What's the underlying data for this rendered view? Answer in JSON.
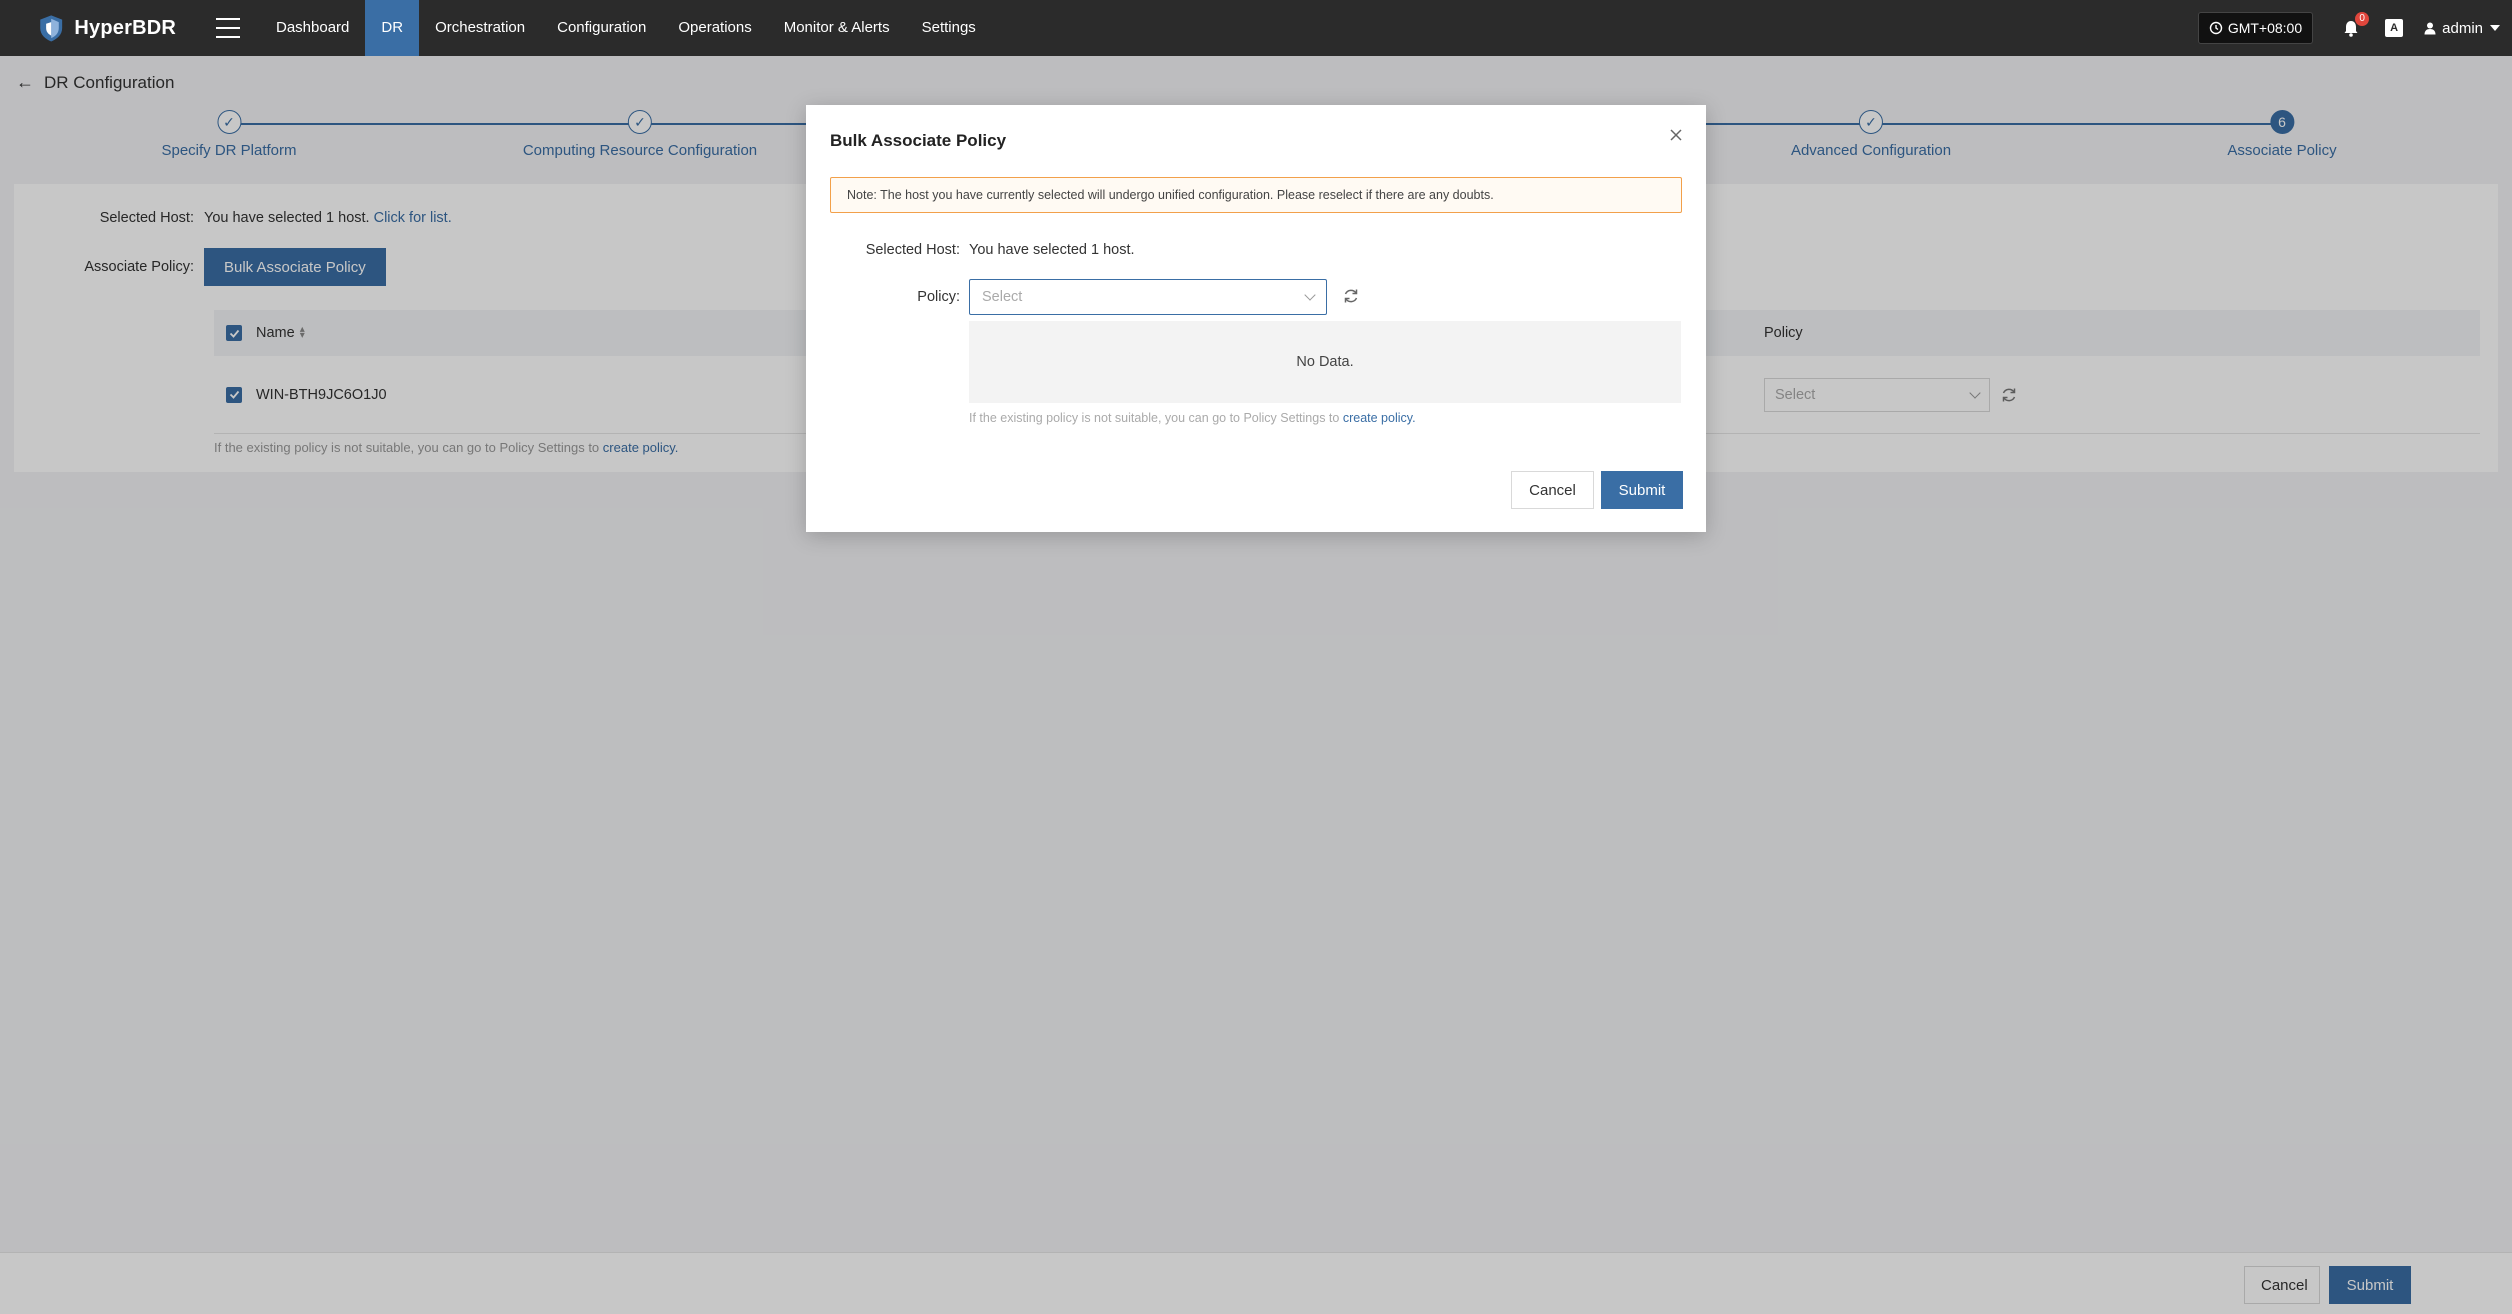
{
  "app": {
    "name": "HyperBDR"
  },
  "nav": {
    "items": [
      "Dashboard",
      "DR",
      "Orchestration",
      "Configuration",
      "Operations",
      "Monitor & Alerts",
      "Settings"
    ],
    "active": "DR"
  },
  "header_right": {
    "timezone": "GMT+08:00",
    "notification_count": "0",
    "lang_icon": "A",
    "user": "admin"
  },
  "page": {
    "title": "DR Configuration"
  },
  "steps": [
    {
      "label": "Specify DR Platform",
      "state": "done"
    },
    {
      "label": "Computing Resource Configuration",
      "state": "done"
    },
    {
      "label": "Advanced Configuration",
      "state": "done"
    },
    {
      "label": "Associate Policy",
      "state": "current",
      "number": "6"
    }
  ],
  "content": {
    "selected_host_label": "Selected Host:",
    "selected_prefix": "You have selected",
    "selected_count": "1",
    "selected_suffix": "host.",
    "click_for_list": "Click for list.",
    "associate_policy_label": "Associate Policy:",
    "bulk_button": "Bulk Associate Policy",
    "table": {
      "headers": {
        "name": "Name",
        "policy": "Policy"
      },
      "rows": [
        {
          "name": "WIN-BTH9JC6O1J0",
          "policy_placeholder": "Select"
        }
      ]
    },
    "hint_prefix": "If the existing policy is not suitable, you can go to Policy Settings to",
    "hint_link": "create policy."
  },
  "footer": {
    "cancel": "Cancel",
    "submit": "Submit"
  },
  "modal": {
    "title": "Bulk Associate Policy",
    "note": "Note: The host you have currently selected will undergo unified configuration. Please reselect if there are any doubts.",
    "selected_host_label": "Selected Host:",
    "selected_host_value": "You have selected 1 host.",
    "policy_label": "Policy:",
    "policy_placeholder": "Select",
    "no_data": "No Data.",
    "hint_prefix": "If the existing policy is not suitable, you can go to Policy Settings to",
    "hint_link": "create policy.",
    "cancel": "Cancel",
    "submit": "Submit"
  },
  "colors": {
    "primary": "#3a6ea5",
    "topbar": "#2b2b2b",
    "warning_border": "#f2a04a"
  },
  "icons": [
    "shield-logo-icon",
    "hamburger-icon",
    "clock-icon",
    "bell-icon",
    "language-icon",
    "user-icon",
    "back-arrow-icon",
    "check-icon",
    "sort-icon",
    "chevron-down-icon",
    "refresh-icon",
    "close-icon"
  ]
}
